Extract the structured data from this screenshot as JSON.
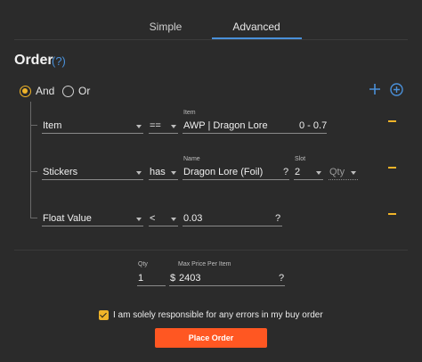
{
  "tabs": [
    {
      "label": "Simple"
    },
    {
      "label": "Advanced"
    }
  ],
  "order": {
    "title": "Order",
    "help": "(?)"
  },
  "logic": {
    "and_label": "And",
    "or_label": "Or",
    "selected": "And"
  },
  "rows": [
    {
      "field": "Item",
      "operator": "==",
      "value_label": "Item",
      "value": "AWP | Dragon Lore",
      "extra": "0 - 0.7"
    },
    {
      "field": "Stickers",
      "operator": "has",
      "value_label": "Name",
      "value": "Dragon Lore (Foil)",
      "value_help": "?",
      "slot_label": "Slot",
      "slot": "2",
      "qty_placeholder": "Qty"
    },
    {
      "field": "Float Value",
      "operator": "<",
      "value": "0.03",
      "value_help": "?"
    }
  ],
  "purchase": {
    "qty_label": "Qty",
    "qty": "1",
    "price_label": "Max Price Per Item",
    "currency": "$",
    "price": "2403",
    "price_help": "?"
  },
  "agreement": {
    "text": "I am solely responsible for any errors in my buy order",
    "checked": true
  },
  "submit": {
    "label": "Place Order"
  },
  "colors": {
    "accent": "#4a90d9",
    "warning": "#f0b429",
    "primary_button": "#ff5722"
  },
  "icons": {
    "add_condition": "plus-icon",
    "add_group": "plus-circle-icon",
    "remove_row": "minus-icon"
  }
}
